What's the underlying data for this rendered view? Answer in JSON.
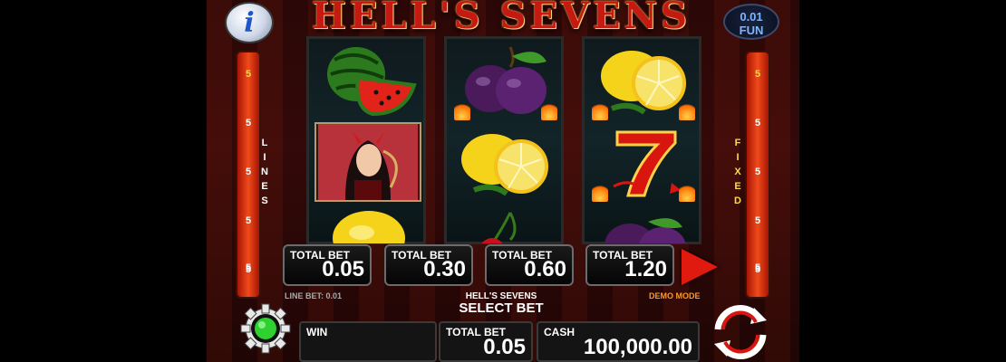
{
  "game": {
    "title": "HELL'S SEVENS",
    "info_label": "i",
    "fun_top": "0.01",
    "fun_bottom": "FUN",
    "demo_mode": "DEMO MODE",
    "line_bet": "LINE BET: 0.01",
    "select_bet": "SELECT BET",
    "game_name_small": "HELL'S SEVENS"
  },
  "left_bar": {
    "top": "5",
    "numbers": [
      "5",
      "5",
      "5",
      "5",
      "5"
    ],
    "vertical_label": [
      "L",
      "I",
      "N",
      "E",
      "S"
    ]
  },
  "right_bar": {
    "top": "5",
    "numbers": [
      "5",
      "5",
      "5",
      "5",
      "5"
    ],
    "vertical_label": [
      "F",
      "I",
      "X",
      "E",
      "D"
    ]
  },
  "reels": [
    {
      "symbols": [
        "watermelon",
        "devil-girl",
        "lemon"
      ]
    },
    {
      "symbols": [
        "plum",
        "lemon",
        "cherry"
      ]
    },
    {
      "symbols": [
        "lemon",
        "seven",
        "plum"
      ]
    }
  ],
  "bet_options": [
    {
      "label": "TOTAL BET",
      "value": "0.05"
    },
    {
      "label": "TOTAL BET",
      "value": "0.30"
    },
    {
      "label": "TOTAL BET",
      "value": "0.60"
    },
    {
      "label": "TOTAL BET",
      "value": "1.20"
    }
  ],
  "bottom": {
    "win_label": "WIN",
    "win_value": "",
    "total_bet_label": "TOTAL BET",
    "total_bet_value": "0.05",
    "cash_label": "CASH",
    "cash_value": "100,000.00"
  },
  "icons": [
    "info-icon",
    "settings-gear-icon",
    "spin-icon",
    "play-arrow-icon"
  ],
  "colors": {
    "accent_red": "#e11a10",
    "gear_green": "#2ed12e",
    "fun_blue": "#7fb4ff",
    "demo_orange": "#ff9a1a"
  }
}
